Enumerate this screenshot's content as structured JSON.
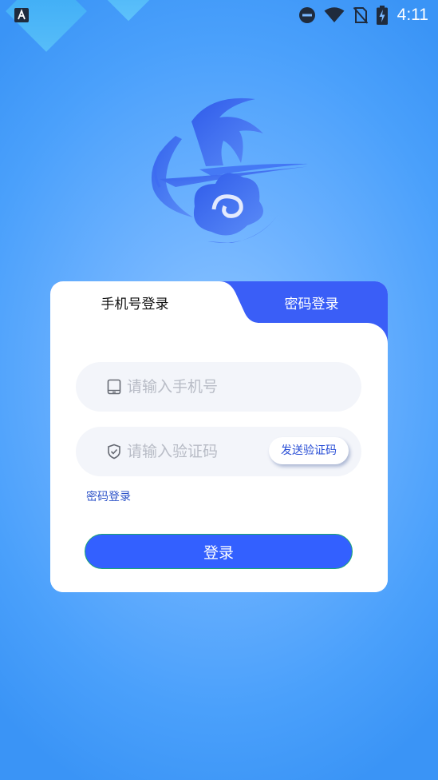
{
  "status_bar": {
    "app_icon": "a-letter-icon",
    "icons": [
      "dnd-icon",
      "wifi-icon",
      "no-sim-icon",
      "battery-charging-icon"
    ],
    "time": "4:11"
  },
  "logo": {
    "icon": "brand-logo-icon",
    "color": "#3d6bf2"
  },
  "tabs": {
    "phone_login": "手机号登录",
    "password_login": "密码登录"
  },
  "form": {
    "phone": {
      "icon": "tablet-icon",
      "placeholder": "请输入手机号",
      "value": ""
    },
    "code": {
      "icon": "shield-check-icon",
      "placeholder": "请输入验证码",
      "value": ""
    },
    "send_code_label": "发送验证码",
    "password_login_link": "密码登录",
    "login_label": "登录"
  },
  "colors": {
    "accent": "#3360ff",
    "tab_active_bg": "#ffffff",
    "tab_inactive_bg": "#3a5ef7",
    "link": "#2c52c8",
    "login_border": "#1aa873"
  }
}
